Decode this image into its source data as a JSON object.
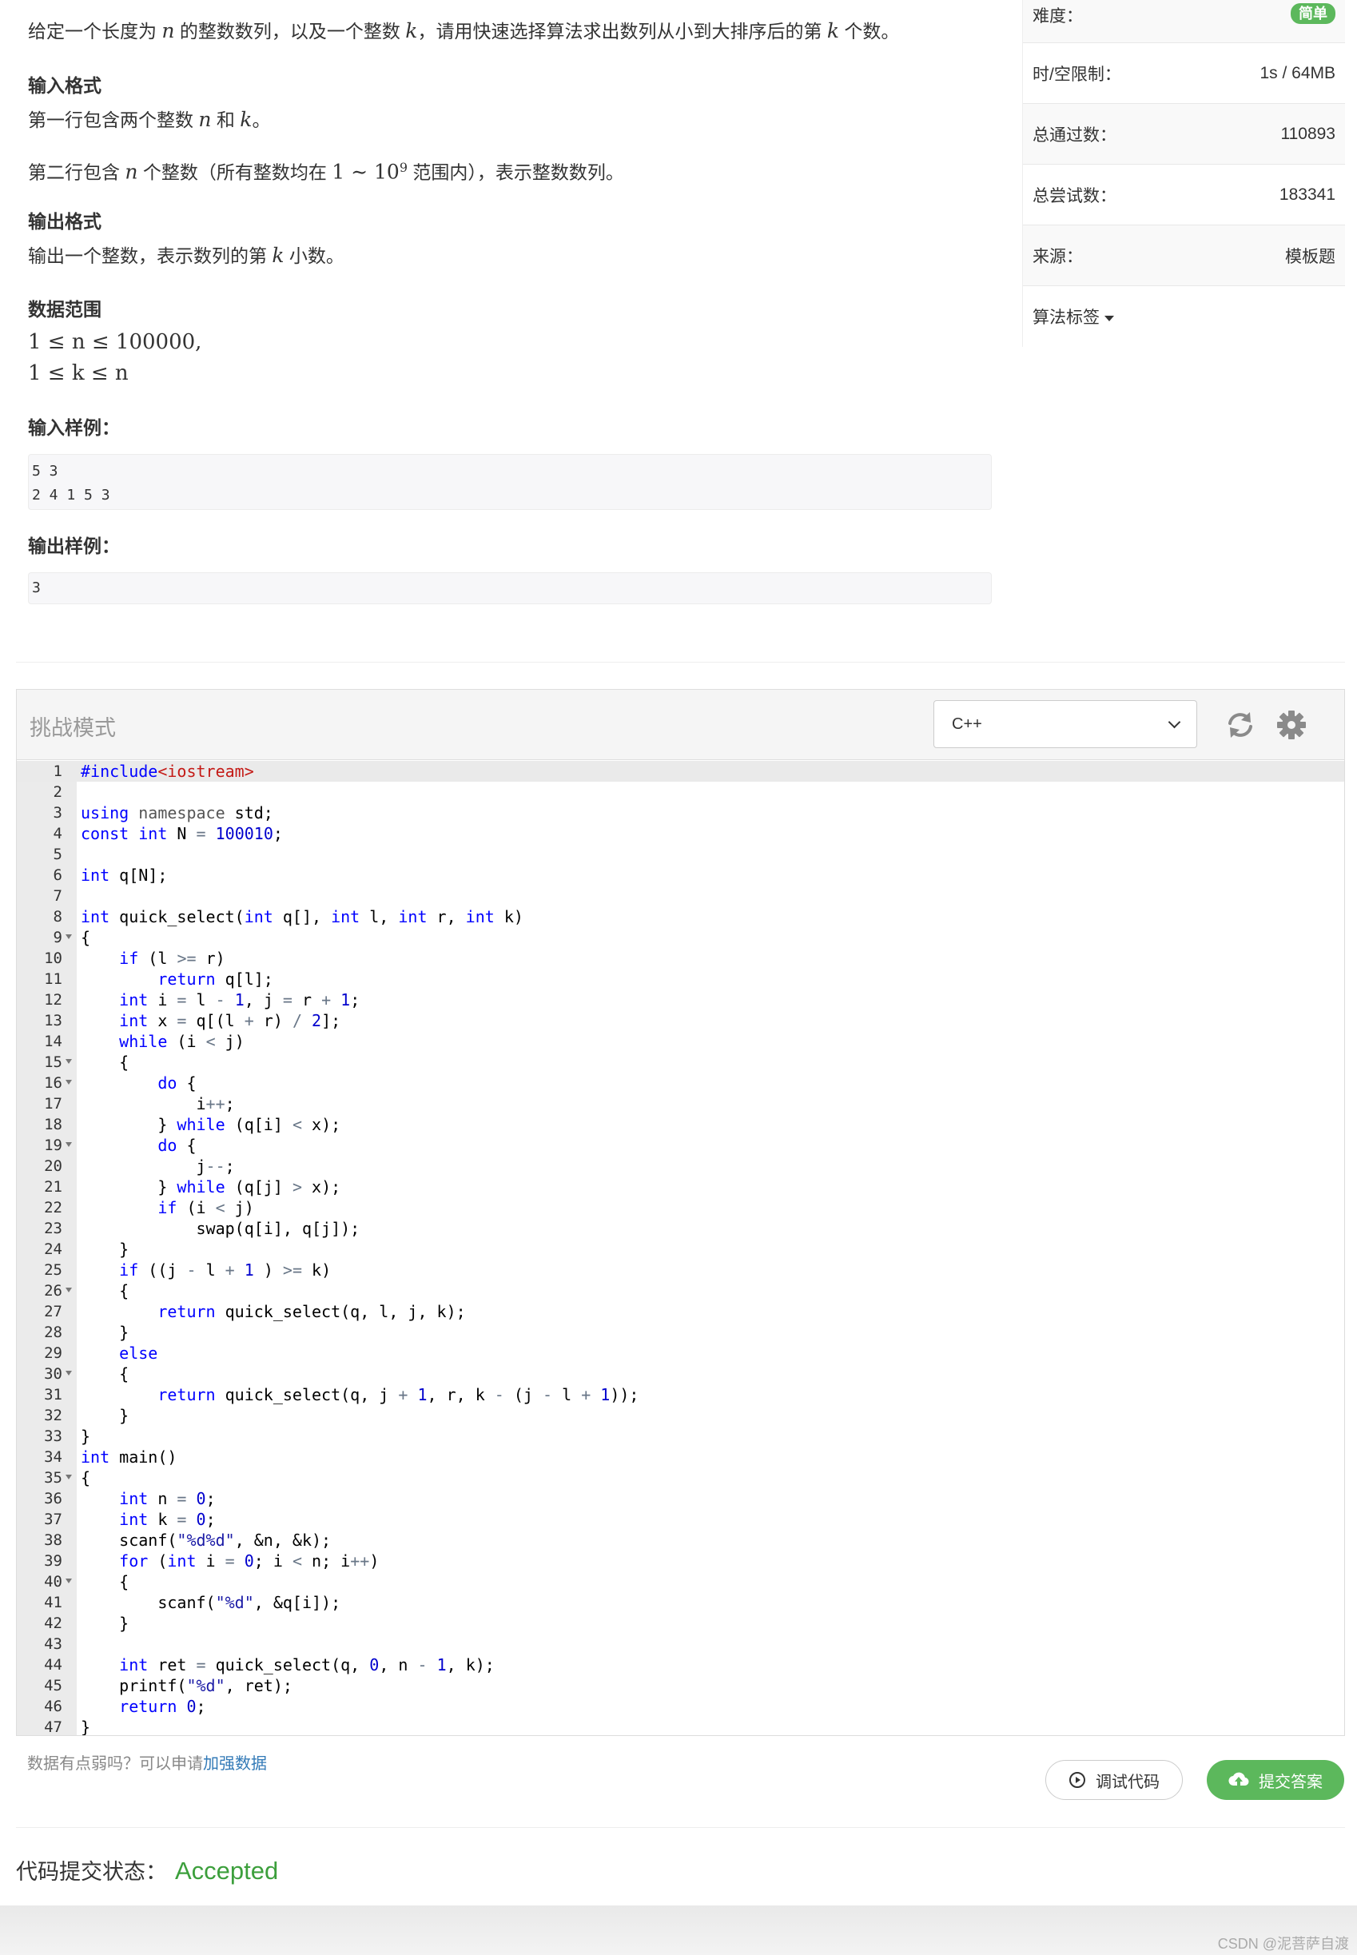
{
  "problem": {
    "intro": [
      "给定一个长度为 ",
      "n",
      " 的整数数列，以及一个整数 ",
      "k",
      "，请用快速选择算法求出数列从小到大排序后的第 ",
      "k",
      " 个数。"
    ],
    "input_title": "输入格式",
    "input_line1": [
      "第一行包含两个整数 ",
      "n",
      " 和 ",
      "k",
      "。"
    ],
    "input_line2": [
      "第二行包含 ",
      "n",
      " 个整数（所有整数均在 ",
      "1 ∼ 10",
      "9",
      " 范围内），表示整数数列。"
    ],
    "output_title": "输出格式",
    "output_line": [
      "输出一个整数，表示数列的第 ",
      "k",
      " 小数。"
    ],
    "range_title": "数据范围",
    "range_line1": "1 ≤ n ≤ 100000,",
    "range_line2": "1 ≤ k ≤ n",
    "sample_in_title": "输入样例：",
    "sample_in": "5 3\n2 4 1 5 3",
    "sample_out_title": "输出样例：",
    "sample_out": "3"
  },
  "info": {
    "difficulty_label": "难度：",
    "difficulty_value": "简单",
    "limit_label": "时/空限制：",
    "limit_value": "1s / 64MB",
    "passed_label": "总通过数：",
    "passed_value": "110893",
    "tried_label": "总尝试数：",
    "tried_value": "183341",
    "source_label": "来源：",
    "source_value": "模板题",
    "tags_label": "算法标签"
  },
  "editor": {
    "mode_title": "挑战模式",
    "language": "C++",
    "refresh_icon": "refresh-icon",
    "settings_icon": "gear-icon",
    "fold_lines": [
      9,
      15,
      16,
      19,
      26,
      30,
      35,
      40
    ],
    "code": [
      "#include<iostream>",
      "",
      "using namespace std;",
      "const int N = 100010;",
      "",
      "int q[N];",
      "",
      "int quick_select(int q[], int l, int r, int k)",
      "{",
      "    if (l >= r)",
      "        return q[l];",
      "    int i = l - 1, j = r + 1;",
      "    int x = q[(l + r) / 2];",
      "    while (i < j)",
      "    {",
      "        do {",
      "            i++;",
      "        } while (q[i] < x);",
      "        do {",
      "            j--;",
      "        } while (q[j] > x);",
      "        if (i < j)",
      "            swap(q[i], q[j]);",
      "    }",
      "    if ((j - l + 1 ) >= k)",
      "    {",
      "        return quick_select(q, l, j, k);",
      "    }",
      "    else",
      "    {",
      "        return quick_select(q, j + 1, r, k - (j - l + 1));",
      "    }",
      "}",
      "int main()",
      "{",
      "    int n = 0;",
      "    int k = 0;",
      "    scanf(\"%d%d\", &n, &k);",
      "    for (int i = 0; i < n; i++)",
      "    {",
      "        scanf(\"%d\", &q[i]);",
      "    }",
      "",
      "    int ret = quick_select(q, 0, n - 1, k);",
      "    printf(\"%d\", ret);",
      "    return 0;",
      "}"
    ]
  },
  "footer": {
    "weak_note": "数据有点弱吗？可以申请",
    "weak_link": "加强数据",
    "debug_label": "调试代码",
    "submit_label": "提交答案",
    "status_label": "代码提交状态：",
    "status_value": "Accepted"
  },
  "watermark": "CSDN @泥菩萨自渡"
}
